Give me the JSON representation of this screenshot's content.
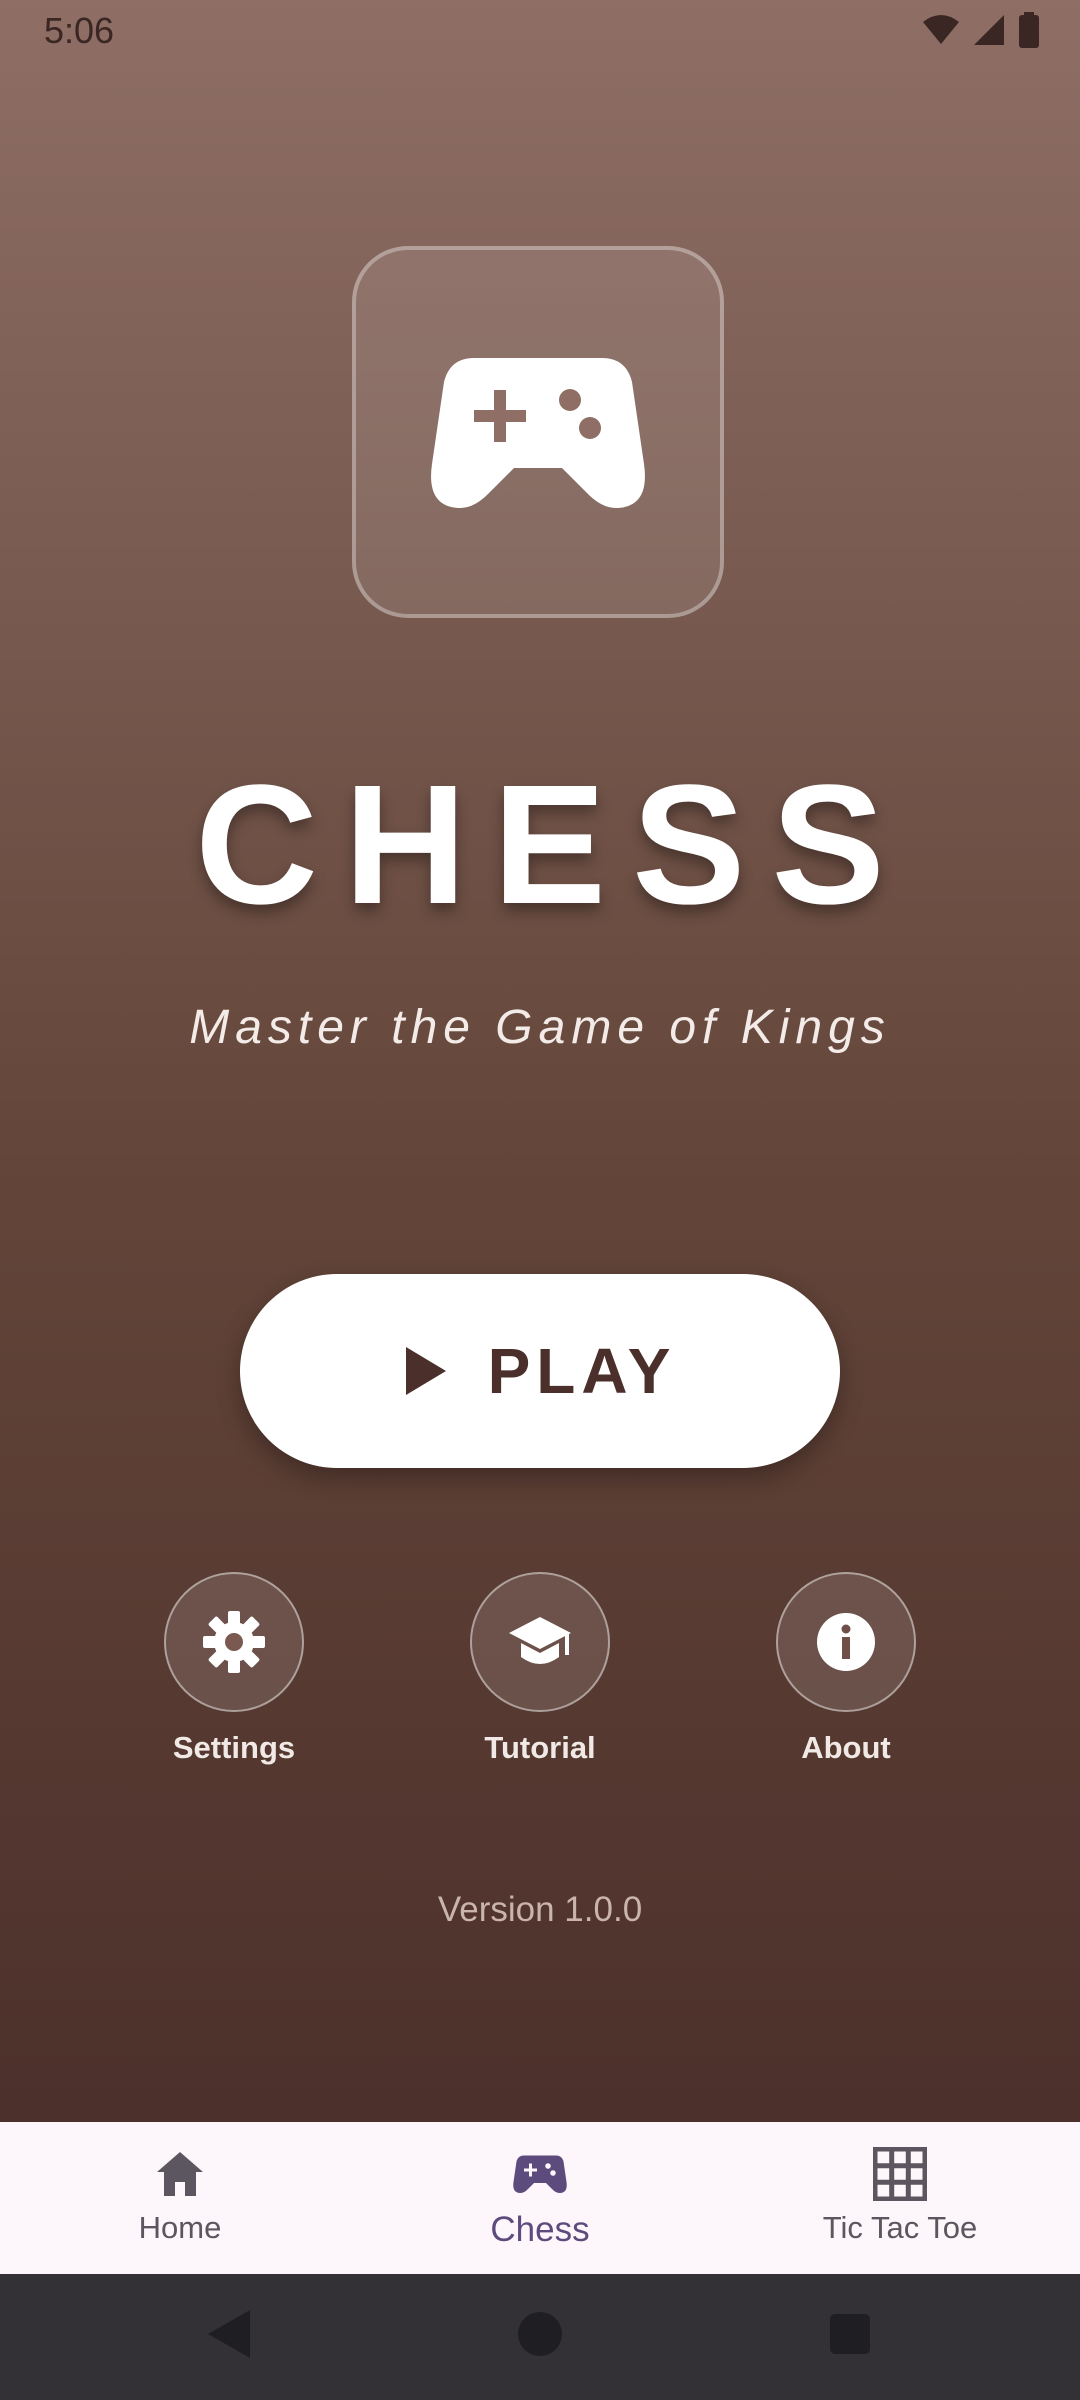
{
  "status_bar": {
    "time": "5:06"
  },
  "app": {
    "title": "CHESS",
    "subtitle": "Master the Game of Kings",
    "play_label": "PLAY",
    "actions": [
      {
        "label": "Settings",
        "icon": "gear-icon"
      },
      {
        "label": "Tutorial",
        "icon": "graduation-cap-icon"
      },
      {
        "label": "About",
        "icon": "info-icon"
      }
    ],
    "version": "Version 1.0.0"
  },
  "bottom_nav": {
    "items": [
      {
        "label": "Home",
        "icon": "home-icon",
        "active": false
      },
      {
        "label": "Chess",
        "icon": "gamepad-icon",
        "active": true
      },
      {
        "label": "Tic Tac Toe",
        "icon": "grid-icon",
        "active": false
      }
    ]
  },
  "colors": {
    "gradient_top": "#8e6e65",
    "gradient_bottom": "#4c302b",
    "active_nav": "#5d4b7e",
    "nav_background": "#fdf6fa"
  }
}
